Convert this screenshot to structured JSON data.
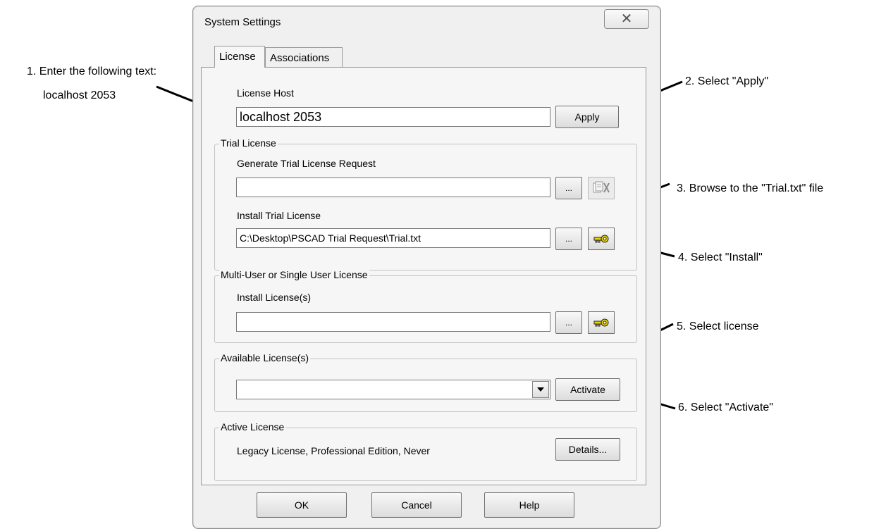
{
  "annotations": {
    "step1_line1": "1. Enter the following text:",
    "step1_line2": "localhost  2053",
    "step2": "2. Select \"Apply\"",
    "step3": "3. Browse to the \"Trial.txt\" file",
    "step4": "4. Select \"Install\"",
    "step5": "5. Select license",
    "step6": "6. Select \"Activate\""
  },
  "window": {
    "title": "System Settings",
    "close_glyph": "✕"
  },
  "tabs": [
    {
      "label": "License",
      "active": true
    },
    {
      "label": "Associations",
      "active": false
    }
  ],
  "license_host": {
    "label": "License Host",
    "value": "localhost 2053",
    "apply_label": "Apply"
  },
  "trial_license": {
    "group_label": "Trial License",
    "generate_label": "Generate Trial License Request",
    "generate_value": "",
    "install_label": "Install Trial License",
    "install_value": "C:\\Desktop\\PSCAD Trial Request\\Trial.txt",
    "browse_label": "..."
  },
  "multi_user": {
    "group_label": "Multi-User or Single User License",
    "install_label": "Install License(s)",
    "install_value": "",
    "browse_label": "..."
  },
  "available": {
    "group_label": "Available License(s)",
    "selected": "",
    "activate_label": "Activate"
  },
  "active": {
    "group_label": "Active License",
    "value": "Legacy License,  Professional Edition,  Never",
    "details_label": "Details..."
  },
  "footer": {
    "ok_label": "OK",
    "cancel_label": "Cancel",
    "help_label": "Help"
  },
  "icons": {
    "generate": "request-generate-icon",
    "install": "key-icon"
  },
  "colors": {
    "key": "#e6d600",
    "window_bg": "#f0f0f0"
  }
}
